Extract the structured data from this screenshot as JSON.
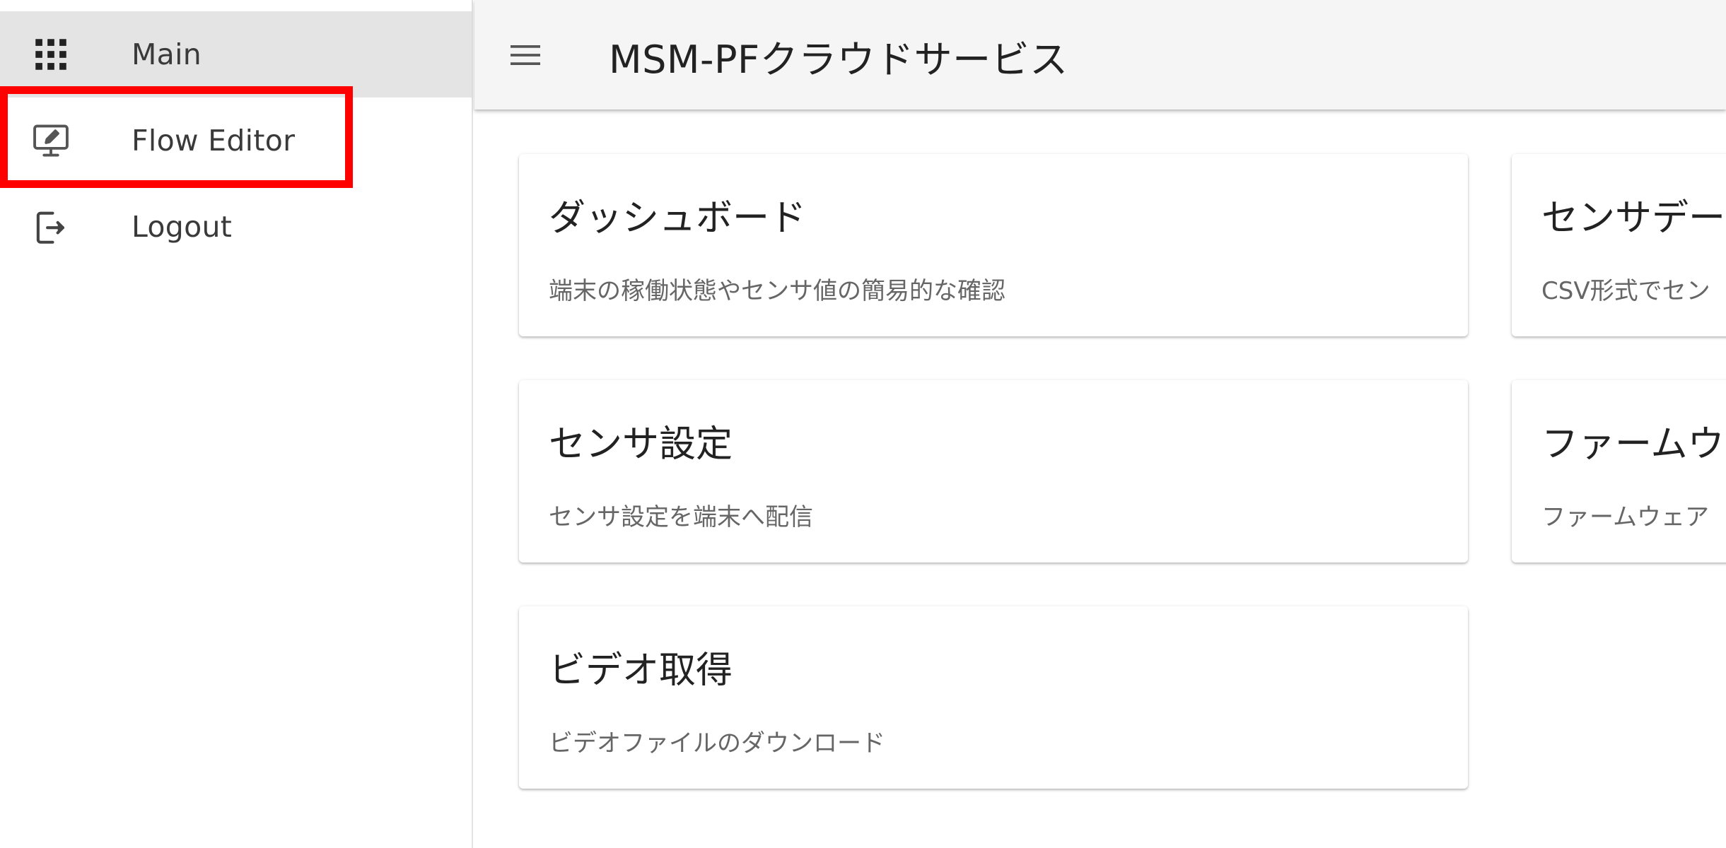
{
  "sidebar": {
    "items": [
      {
        "label": "Main",
        "icon": "apps-grid-icon",
        "active": true
      },
      {
        "label": "Flow Editor",
        "icon": "monitor-edit-icon",
        "active": false
      },
      {
        "label": "Logout",
        "icon": "logout-icon",
        "active": false
      }
    ]
  },
  "appbar": {
    "title": "MSM-PFクラウドサービス",
    "menu_icon": "hamburger-menu-icon"
  },
  "cards": [
    {
      "title": "ダッシュボード",
      "description": "端末の稼働状態やセンサ値の簡易的な確認"
    },
    {
      "title": "センサデー",
      "description": "CSV形式でセン"
    },
    {
      "title": "センサ設定",
      "description": "センサ設定を端末へ配信"
    },
    {
      "title": "ファームウ",
      "description": "ファームウェア"
    },
    {
      "title": "ビデオ取得",
      "description": "ビデオファイルのダウンロード"
    }
  ],
  "annotation": {
    "color": "#ff0000",
    "target": "Flow Editor"
  },
  "colors": {
    "appbar_bg": "#f5f5f5",
    "sidebar_active_bg": "#e4e4e4",
    "highlight": "#ff0000"
  }
}
